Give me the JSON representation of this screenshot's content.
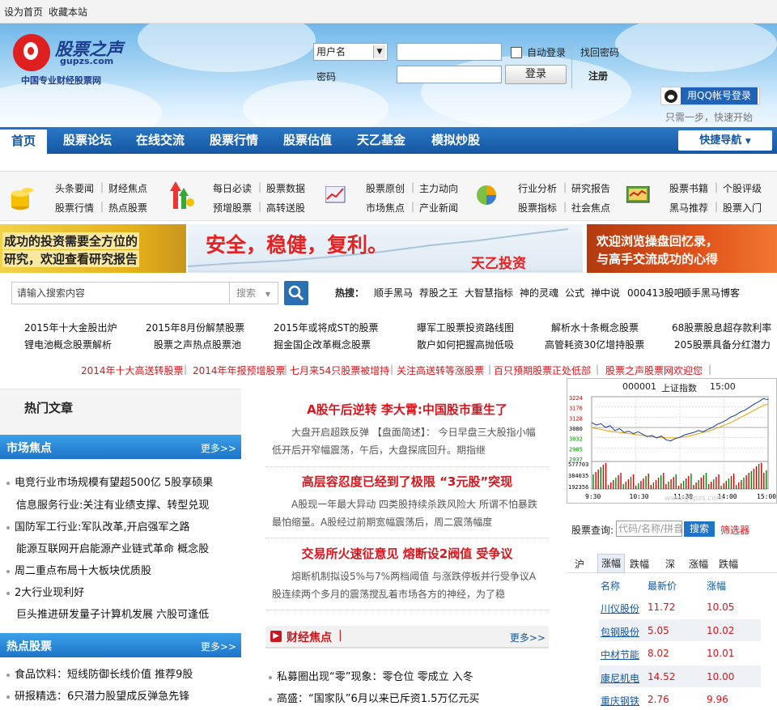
{
  "topbar": {
    "set_home": "设为首页",
    "bookmark": "收藏本站"
  },
  "logo": {
    "cn": "股票之声",
    "en": "gupzs.com",
    "slogan": "中国专业财经股票网"
  },
  "login": {
    "username_option": "用户名",
    "password_label": "密码",
    "auto_login": "自动登录",
    "forgot": "找回密码",
    "login_btn": "登录",
    "register": "注册",
    "qq_login": "用QQ帐号登录",
    "qq_hint": "只需一步，快速开始"
  },
  "nav": {
    "items": [
      "首页",
      "股票论坛",
      "在线交流",
      "股票行情",
      "股票估值",
      "天乙基金",
      "模拟炒股"
    ],
    "quick": "快捷导航"
  },
  "quick_links": [
    [
      "头条要闻",
      "财经焦点",
      "股票行情",
      "热点股票"
    ],
    [
      "每日必读",
      "股票数据",
      "预增股票",
      "高转送股"
    ],
    [
      "股票原创",
      "主力动向",
      "市场焦点",
      "产业新闻"
    ],
    [
      "行业分析",
      "研究报告",
      "股票指标",
      "社会焦点"
    ],
    [
      "股票书籍",
      "个股评级",
      "黑马推荐",
      "股票入门"
    ]
  ],
  "banners": {
    "left": [
      "成功的投资需要全方位的",
      "研究，欢迎查看研究报告"
    ],
    "middle": "安全，稳健，复利。",
    "middle_brand": "天乙投资",
    "right": [
      "欢迎浏览操盘回忆录，",
      "与高手交流成功的心得"
    ]
  },
  "search": {
    "placeholder": "请输入搜索内容",
    "type": "搜索",
    "hot_label": "热搜：",
    "hot": [
      "顺手黑马",
      "荐股之王",
      "大智慧指标",
      "神的灵魂",
      "公式",
      "禅中说",
      "000413股吧",
      "顺手黑马博客"
    ]
  },
  "links_row1": [
    "2015年十大金股出炉",
    "2015年8月份解禁股票",
    "2015年或将成ST的股票",
    "曝军工股票投资路线图",
    "解析水十条概念股票",
    "68股票股息超存款利率"
  ],
  "links_row2": [
    "锂电池概念股票解析",
    "股票之声热点股票池",
    "掘金国企改革概念股票",
    "散户如何把握高抛低吸",
    "高管耗资30亿增持股票",
    "205股票具备分红潜力"
  ],
  "red_links": [
    "2014年十大高送转股票",
    "2014年年报预增股票",
    "七月来54只股票被增持",
    "关注高送转等涨股票",
    "百只预期股票正处低部",
    "股票之声股票网欢迎您"
  ],
  "hot_articles": {
    "title": "热门文章"
  },
  "market_focus": {
    "title": "市场焦点",
    "more": "更多>>",
    "items": [
      {
        "text": "电竞行业市场规模有望超500亿  5股享硕果",
        "dot": true
      },
      {
        "text": "信息服务行业:关注有业绩支撑、转型兑现",
        "dot": false
      },
      {
        "text": "国防军工行业:军队改革,开启强军之路",
        "dot": true
      },
      {
        "text": "能源互联网开启能源产业链式革命  概念股",
        "dot": false
      },
      {
        "text": "周二重点布局十大板块优质股",
        "dot": true
      },
      {
        "text": "2大行业现利好",
        "dot": true
      },
      {
        "text": "巨头推进研发量子计算机发展  六股可逢低",
        "dot": false
      }
    ]
  },
  "hot_stocks": {
    "title": "热点股票",
    "more": "更多>>",
    "items": [
      "食品饮料：短线防御长线价值 推荐9股",
      "研报精选：6只潜力股望成反弹急先锋"
    ]
  },
  "news": [
    {
      "title": "A股午后逆转  李大霄:中国股市重生了",
      "summary": "大盘开启超跌反弹     【盘面简述】：     今日早盘三大股指小幅低开后开窄幅震荡，午后，大盘探底回升。期指继"
    },
    {
      "title": "高层容忍度已经到了极限  “3元股”突现",
      "summary": "A股现一年最大异动  四类股持续杀跌风险大      所谓不怕暴跌最怕缩量。A股经过前期宽幅震荡后，周二震荡幅度"
    },
    {
      "title": "交易所火速征意见  熔断设2阀值  受争议",
      "summary": "熔断机制拟设5%与7%两档阈值  与涨跌停板并行受争议A股连续两个多月的震荡搅乱着市场各方的神经，为了稳"
    }
  ],
  "finance_focus": {
    "title": "财经焦点",
    "more": "更多>>",
    "items": [
      "私募圈出现“零”现象：零仓位  零成立  入冬",
      "高盛：“国家队”6月以来已斥资1.5万亿元买"
    ]
  },
  "chart": {
    "code": "000001",
    "name": "上证指数",
    "time": "15:00",
    "y_labels": [
      "3224",
      "3176",
      "3128",
      "3080",
      "3032",
      "2985",
      "2937"
    ],
    "vol_labels": [
      "577703",
      "384035",
      "192356"
    ],
    "x_labels": [
      "9:30",
      "10:30",
      "11:30",
      "14:00",
      "15:00"
    ],
    "watermark": "www.gupzs.com"
  },
  "stock_query": {
    "label": "股票查询:",
    "placeholder": "代码/名称/拼音",
    "search_btn": "搜索",
    "screener": "筛选器"
  },
  "rank_tabs": [
    "沪",
    "涨幅",
    "跌幅",
    "深",
    "涨幅",
    "跌幅"
  ],
  "rank_table": {
    "headers": [
      "名称",
      "最新价",
      "涨幅"
    ],
    "rows": [
      [
        "川仪股份",
        "11.72",
        "10.05"
      ],
      [
        "包钢股份",
        "5.05",
        "10.02"
      ],
      [
        "中材节能",
        "8.02",
        "10.01"
      ],
      [
        "康尼机电",
        "14.52",
        "10.00"
      ],
      [
        "重庆钢铁",
        "2.76",
        "9.96"
      ]
    ]
  }
}
